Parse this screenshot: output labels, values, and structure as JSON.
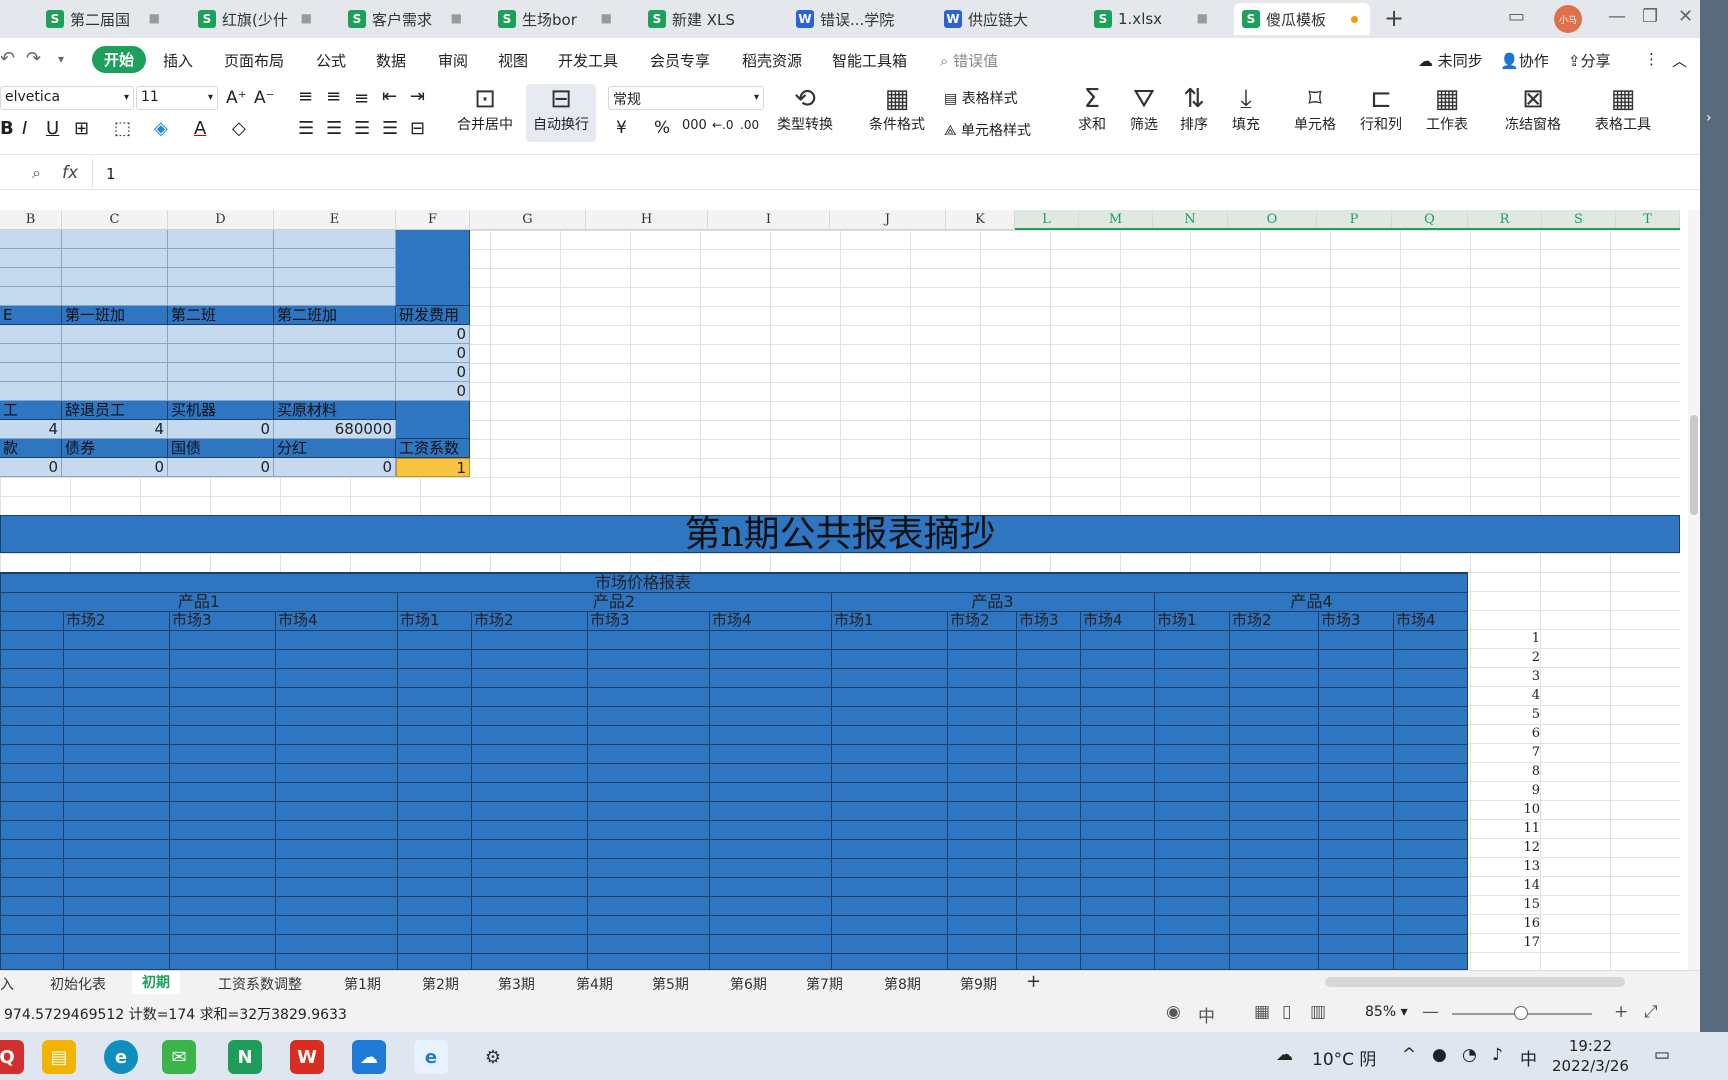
{
  "tabs": [
    {
      "label": "第二届国",
      "type": "s"
    },
    {
      "label": "红旗(少什",
      "type": "s"
    },
    {
      "label": "客户需求",
      "type": "s"
    },
    {
      "label": "生场bor",
      "type": "s"
    },
    {
      "label": "新建 XLS",
      "type": "s"
    },
    {
      "label": "错误...学院",
      "type": "w"
    },
    {
      "label": "供应链大",
      "type": "w"
    },
    {
      "label": "1.xlsx",
      "type": "s"
    },
    {
      "label": "傻瓜模板",
      "type": "s"
    }
  ],
  "avatar": "小马",
  "menu": {
    "items": [
      "开始",
      "插入",
      "页面布局",
      "公式",
      "数据",
      "审阅",
      "视图",
      "开发工具",
      "会员专享",
      "稻壳资源",
      "智能工具箱"
    ],
    "search": "错误值",
    "sync": "未同步",
    "collab": "协作",
    "share": "分享"
  },
  "ribbon": {
    "font_name": "elvetica",
    "font_size": "11",
    "merge": "合并居中",
    "wrap": "自动换行",
    "number_format": "常规",
    "convert": "类型转换",
    "cond_format": "条件格式",
    "table_style": "表格样式",
    "cell_style": "单元格样式",
    "sum": "求和",
    "filter": "筛选",
    "sort": "排序",
    "fill": "填充",
    "cell": "单元格",
    "rowcol": "行和列",
    "worksheet": "工作表",
    "freeze": "冻结窗格",
    "table_tools": "表格工具"
  },
  "formula": {
    "fx": "fx",
    "value": "1"
  },
  "columns": [
    "B",
    "C",
    "D",
    "E",
    "F",
    "G",
    "H",
    "I",
    "J",
    "K",
    "L",
    "M",
    "N",
    "O",
    "P",
    "Q",
    "R",
    "S",
    "T"
  ],
  "upper": {
    "row1": [
      "E",
      "第一班加",
      "第二班",
      "第二班加",
      "研发费用"
    ],
    "zeros": [
      "0",
      "0",
      "0",
      "0"
    ],
    "row2": [
      "工",
      "辞退员工",
      "买机器",
      "买原材料"
    ],
    "row2v": [
      "4",
      "4",
      "0",
      "680000"
    ],
    "row3": [
      "款",
      "债券",
      "国债",
      "分红",
      "工资系数"
    ],
    "row3v": [
      "0",
      "0",
      "0",
      "0",
      "1"
    ]
  },
  "report_title": "第n期公共报表摘抄",
  "market": {
    "title": "市场价格报表",
    "products": [
      "产品1",
      "产品2",
      "产品3",
      "产品4"
    ],
    "p1_markets": [
      "市场2",
      "市场3",
      "市场4"
    ],
    "p2_markets": [
      "市场1",
      "市场2",
      "市场3",
      "市场4"
    ],
    "p3_markets": [
      "市场1",
      "市场2",
      "市场3",
      "市场4"
    ],
    "p4_markets": [
      "市场1",
      "市场2",
      "市场3",
      "市场4"
    ]
  },
  "row_numbers": [
    "1",
    "2",
    "3",
    "4",
    "5",
    "6",
    "7",
    "8",
    "9",
    "10",
    "11",
    "12",
    "13",
    "14",
    "15",
    "16",
    "17"
  ],
  "sheets": [
    "入",
    "初始化表",
    "初期",
    "工资系数调整",
    "第1期",
    "第2期",
    "第3期",
    "第4期",
    "第5期",
    "第6期",
    "第7期",
    "第8期",
    "第9期"
  ],
  "status": {
    "text": "974.5729469512 计数=174 求和=32万3829.9633",
    "zoom": "85%"
  },
  "taskbar": {
    "weather": "10°C 阴",
    "ime": "中",
    "time": "19:22",
    "date": "2022/3/26"
  },
  "colors": {
    "accent": "#1da15a",
    "dark_blue": "#2e75c2",
    "light_blue": "#c5d9ef",
    "yellow": "#f6c342"
  }
}
